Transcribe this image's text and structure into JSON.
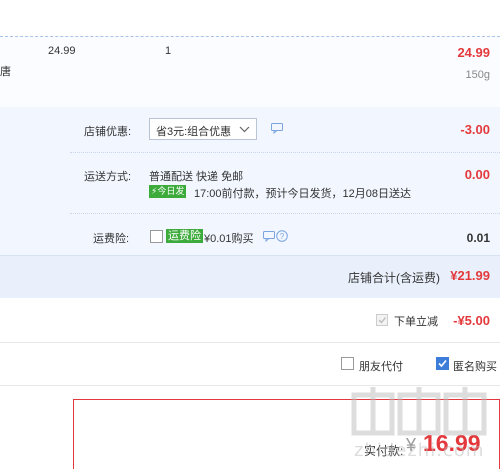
{
  "item": {
    "name_fragment": "唐",
    "unit_price": "24.99",
    "quantity": "1",
    "subtotal": "24.99",
    "weight": "150g"
  },
  "shop_discount": {
    "label": "店铺优惠:",
    "selected": "省3元:组合优惠",
    "amount": "-3.00"
  },
  "shipping": {
    "label": "运送方式:",
    "method": "普通配送 快递 免邮",
    "badge": "今日发",
    "note": "17:00前付款，预计今日发货，12月08日送达",
    "amount": "0.00"
  },
  "insurance": {
    "label": "运费险:",
    "tag": "运费险",
    "price": "¥0.01购买",
    "amount": "0.01"
  },
  "shop_total": {
    "label": "店铺合计(含运费)",
    "amount": "¥21.99"
  },
  "instant_discount": {
    "label": "下单立减",
    "amount": "-¥5.00"
  },
  "options": {
    "friend_pay": "朋友代付",
    "anonymous": "匿名购买"
  },
  "order": {
    "paid_label": "实付款:",
    "currency": "¥",
    "amount": "16.99"
  },
  "watermark": {
    "site": "zhidezhi.com"
  },
  "colors": {
    "accent_red": "#e4393c",
    "link_blue": "#3b6fc9",
    "badge_green": "#3cab3b"
  }
}
